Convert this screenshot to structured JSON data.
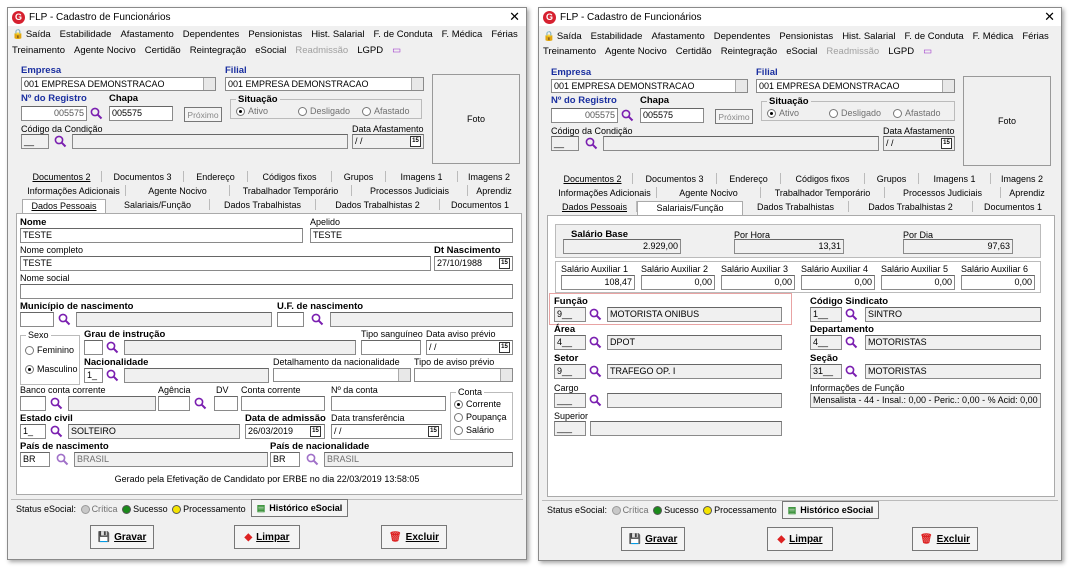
{
  "left": {
    "title": "FLP - Cadastro de Funcionários",
    "menu_row1": [
      "Saída",
      "Estabilidade",
      "Afastamento",
      "Dependentes",
      "Pensionistas",
      "Hist. Salarial",
      "F. de Conduta",
      "F. Médica",
      "Férias"
    ],
    "menu_row2": [
      "Treinamento",
      "Agente Nocivo",
      "Certidão",
      "Reintegração",
      "eSocial",
      "Readmissão",
      "LGPD"
    ],
    "empresa_label": "Empresa",
    "empresa_value": "001 EMPRESA DEMONSTRACAO",
    "filial_label": "Filial",
    "filial_value": "001 EMPRESA DEMONSTRACAO",
    "registro_label": "Nº do Registro",
    "registro_value": "005575",
    "chapa_label": "Chapa",
    "chapa_value": "005575",
    "proximo": "Próximo",
    "situacao_label": "Situação",
    "sit_ativo": "Ativo",
    "sit_desligado": "Desligado",
    "sit_afastado": "Afastado",
    "cond_label": "Código da Condição",
    "cond_value": "__",
    "data_afast_label": "Data Afastamento",
    "data_afast_value": "/ /",
    "foto": "Foto",
    "tabs_row1": [
      "Documentos 2",
      "Documentos 3",
      "Endereço",
      "Códigos fixos",
      "Grupos",
      "Imagens 1",
      "Imagens 2"
    ],
    "tabs_row2": [
      "Informações Adicionais",
      "Agente Nocivo",
      "Trabalhador Temporário",
      "Processos Judiciais",
      "Aprendiz"
    ],
    "tabs_row3": [
      "Dados Pessoais",
      "Salariais/Função",
      "Dados Trabalhistas",
      "Dados Trabalhistas 2",
      "Documentos 1"
    ],
    "nome_label": "Nome",
    "nome_value": "TESTE",
    "apelido_label": "Apelido",
    "apelido_value": "TESTE",
    "nome_completo_label": "Nome completo",
    "nome_completo_value": "TESTE",
    "dt_nasc_label": "Dt Nascimento",
    "dt_nasc_value": "27/10/1988",
    "nome_social_label": "Nome social",
    "municipio_label": "Município de nascimento",
    "uf_label": "U.F. de nascimento",
    "sexo_label": "Sexo",
    "sexo_fem": "Feminino",
    "sexo_masc": "Masculino",
    "grau_label": "Grau de instrução",
    "tipo_sang_label": "Tipo sanguíneo",
    "data_aviso_label": "Data aviso prévio",
    "data_aviso_value": "/ /",
    "nacionalidade_label": "Nacionalidade",
    "nacionalidade_value": "1_",
    "detalhamento_label": "Detalhamento da nacionalidade",
    "tipo_aviso_label": "Tipo de aviso prévio",
    "banco_label": "Banco conta corrente",
    "agencia_label": "Agência",
    "dv_label": "DV",
    "conta_label": "Conta corrente",
    "nconta_label": "Nº da conta",
    "conta_grp": "Conta",
    "conta_corrente": "Corrente",
    "conta_poupanca": "Poupança",
    "conta_salario": "Salário",
    "estado_civil_label": "Estado civil",
    "estado_civil_code": "1_",
    "estado_civil_value": "SOLTEIRO",
    "data_adm_label": "Data de admissão",
    "data_adm_value": "26/03/2019",
    "data_transf_label": "Data transferência",
    "data_transf_value": "/ /",
    "pais_nasc_label": "País de nascimento",
    "pais_nasc_code": "BR",
    "pais_nasc_value": "BRASIL",
    "pais_nac_label": "País de nacionalidade",
    "pais_nac_code": "BR",
    "pais_nac_value": "BRASIL",
    "gerado": "Gerado pela Efetivação de Candidato por ERBE no dia 22/03/2019 13:58:05",
    "status_label": "Status eSocial:",
    "st_critica": "Crítica",
    "st_sucesso": "Sucesso",
    "st_proc": "Processamento",
    "hist_esocial": "Histórico eSocial",
    "gravar": "Gravar",
    "limpar": "Limpar",
    "excluir": "Excluir"
  },
  "right": {
    "sal_base_label": "Salário Base",
    "sal_base_value": "2.929,00",
    "por_hora_label": "Por Hora",
    "por_hora_value": "13,31",
    "por_dia_label": "Por Dia",
    "por_dia_value": "97,63",
    "aux": [
      {
        "label": "Salário Auxiliar 1",
        "value": "108,47"
      },
      {
        "label": "Salário Auxiliar 2",
        "value": "0,00"
      },
      {
        "label": "Salário Auxiliar 3",
        "value": "0,00"
      },
      {
        "label": "Salário Auxiliar 4",
        "value": "0,00"
      },
      {
        "label": "Salário Auxiliar 5",
        "value": "0,00"
      },
      {
        "label": "Salário Auxiliar 6",
        "value": "0,00"
      }
    ],
    "funcao_label": "Função",
    "funcao_code": "9__",
    "funcao_value": "MOTORISTA ONIBUS",
    "sindicato_label": "Código Sindicato",
    "sindicato_code": "1__",
    "sindicato_value": "SINTRO",
    "area_label": "Área",
    "area_code": "4__",
    "area_value": "DPOT",
    "depto_label": "Departamento",
    "depto_code": "4__",
    "depto_value": "MOTORISTAS",
    "setor_label": "Setor",
    "setor_code": "9__",
    "setor_value": "TRAFEGO OP. I",
    "secao_label": "Seção",
    "secao_code": "31__",
    "secao_value": "MOTORISTAS",
    "cargo_label": "Cargo",
    "cargo_code": "___",
    "inf_funcao_label": "Informações de Função",
    "inf_funcao_value": "Mensalista - 44 - Insal.: 0,00 - Peric.: 0,00 - % Acid: 0,00",
    "superior_label": "Superior",
    "superior_code": "___"
  },
  "colors": {
    "accent": "#1a2fa0",
    "highlight": "#e8a3a3",
    "logo": "#d6202f"
  }
}
